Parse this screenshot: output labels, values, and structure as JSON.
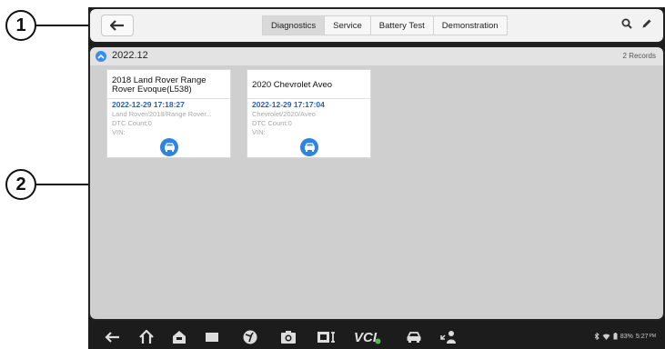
{
  "callouts": [
    "1",
    "2"
  ],
  "header": {
    "tabs": [
      {
        "label": "Diagnostics",
        "active": true
      },
      {
        "label": "Service",
        "active": false
      },
      {
        "label": "Battery Test",
        "active": false
      },
      {
        "label": "Demonstration",
        "active": false
      }
    ]
  },
  "group": {
    "date": "2022.12",
    "records": "2 Records"
  },
  "cards": [
    {
      "title": "2018 Land Rover Range Rover Evoque(L538)",
      "timestamp": "2022-12-29 17:18:27",
      "path": "Land Rover/2018/Range Rover...",
      "dtc": "DTC Count:0",
      "vin": "VIN:"
    },
    {
      "title": "2020 Chevrolet Aveo",
      "timestamp": "2022-12-29 17:17:04",
      "path": "Chevrolet/2020/Aveo",
      "dtc": "DTC Count:0",
      "vin": "VIN:"
    }
  ],
  "navbar": {
    "vci_label": "VCI",
    "status": {
      "battery": "83%",
      "time": "5:27",
      "ampm": "PM"
    }
  },
  "colors": {
    "accent": "#3b8ee8",
    "timestamp": "#2e5ea8",
    "content_bg": "#cfcfcf",
    "navbar_bg": "#1c1c1c"
  },
  "icons": [
    "back-arrow-icon",
    "search-icon",
    "edit-pencil-icon",
    "chevron-up-icon",
    "car-icon",
    "nav-back-icon",
    "home-icon",
    "autel-home-icon",
    "recent-apps-icon",
    "browser-icon",
    "camera-icon",
    "screenshot-icon",
    "vci-icon",
    "vehicle-icon",
    "remote-desk-icon",
    "bluetooth-icon",
    "wifi-icon",
    "battery-icon"
  ]
}
